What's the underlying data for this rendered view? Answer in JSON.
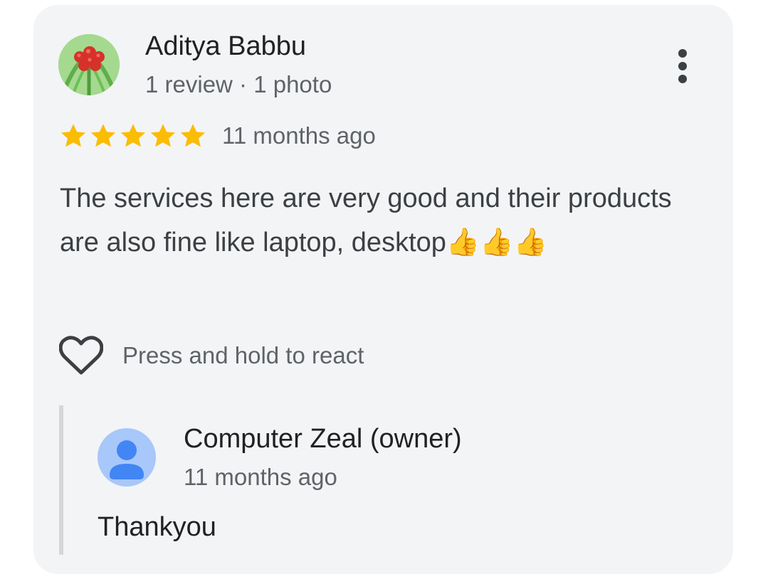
{
  "review": {
    "reviewer_name": "Aditya Babbu",
    "reviewer_meta": "1 review · 1 photo",
    "rating": 5,
    "rating_max": 5,
    "age": "11 months ago",
    "text": "The services here are very good and their products are also fine like laptop, desktop👍👍👍",
    "react_label": "Press and hold to react",
    "star_color": "#fbbc04",
    "icons": {
      "more": "more-vert-icon",
      "react": "heart-outline-icon",
      "star": "star-icon"
    }
  },
  "owner_reply": {
    "name": "Computer Zeal (owner)",
    "age": "11 months ago",
    "text": "Thankyou",
    "avatar_color": "#a8c7fa",
    "avatar_icon_color": "#4285f4"
  }
}
